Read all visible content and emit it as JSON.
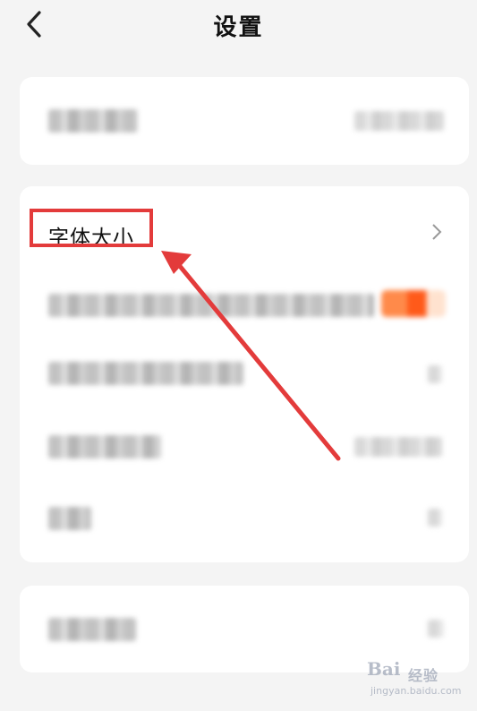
{
  "header": {
    "title": "设置"
  },
  "settings": {
    "font_size_label": "字体大小"
  },
  "annotation": {
    "color": "#e33b3b"
  },
  "watermark": {
    "brand": "Bai",
    "text": "经验",
    "url": "jingyan.baidu.com"
  }
}
